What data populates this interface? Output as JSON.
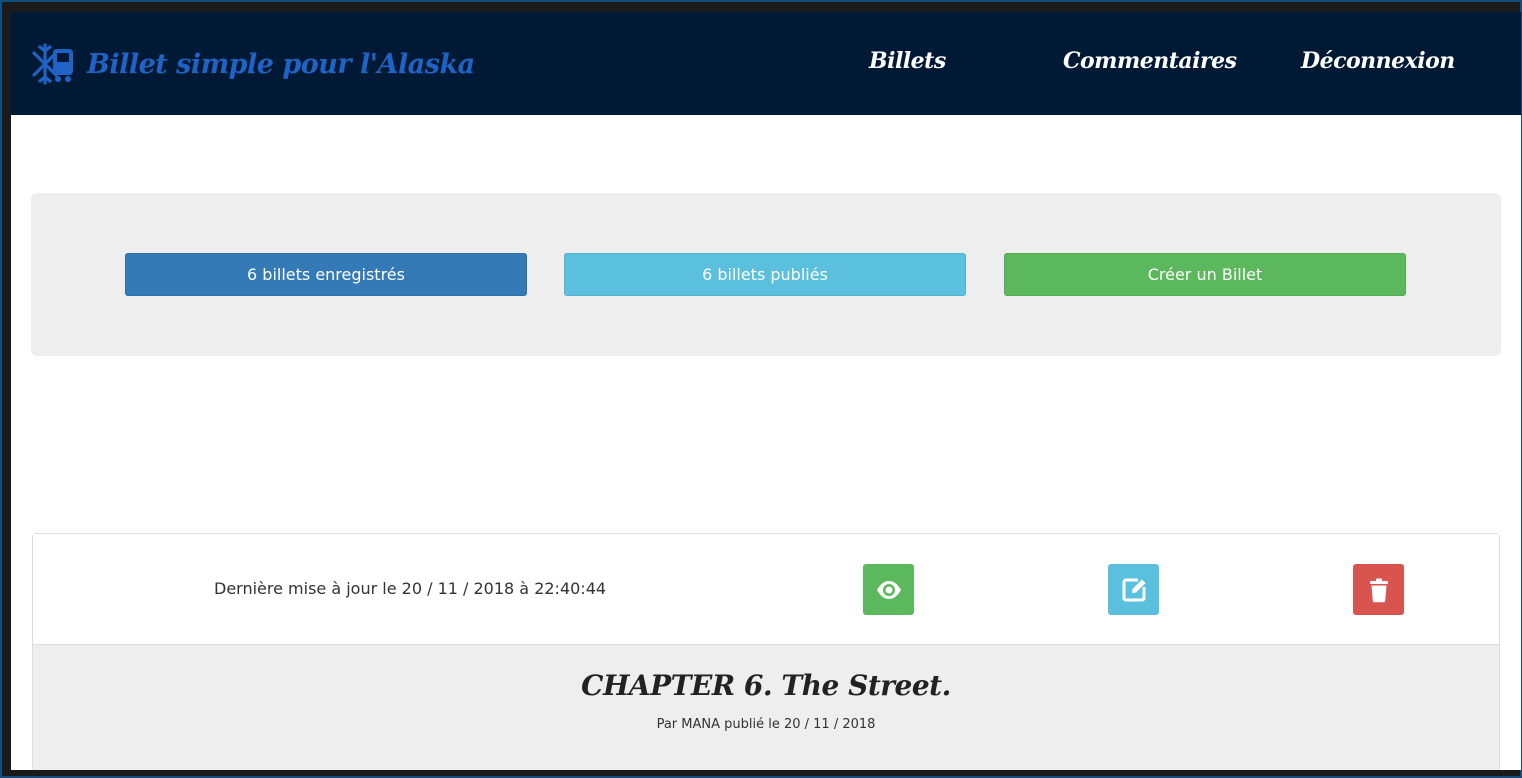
{
  "navbar": {
    "brand": "Billet simple pour l'Alaska",
    "brand_icon": "snowflake-train-icon",
    "links": [
      "Billets",
      "Commentaires",
      "Déconnexion"
    ]
  },
  "stats": {
    "saved_label": "6 billets enregistrés",
    "published_label": "6 billets publiés",
    "create_label": "Créer un Billet"
  },
  "post": {
    "updated": "Dernière mise à jour le 20 / 11 / 2018 à 22:40:44",
    "title": "CHAPTER 6. The Street.",
    "meta": "Par MANA publié le 20 / 11 / 2018",
    "actions": {
      "view_icon": "eye-icon",
      "edit_icon": "edit-icon",
      "delete_icon": "trash-icon"
    }
  },
  "colors": {
    "navbar_bg": "#001a36",
    "brand": "#1f63c6",
    "primary": "#337ab7",
    "info": "#5bc0de",
    "success": "#5cb85c",
    "danger": "#d9534f",
    "panel_bg": "#eeeeee"
  }
}
